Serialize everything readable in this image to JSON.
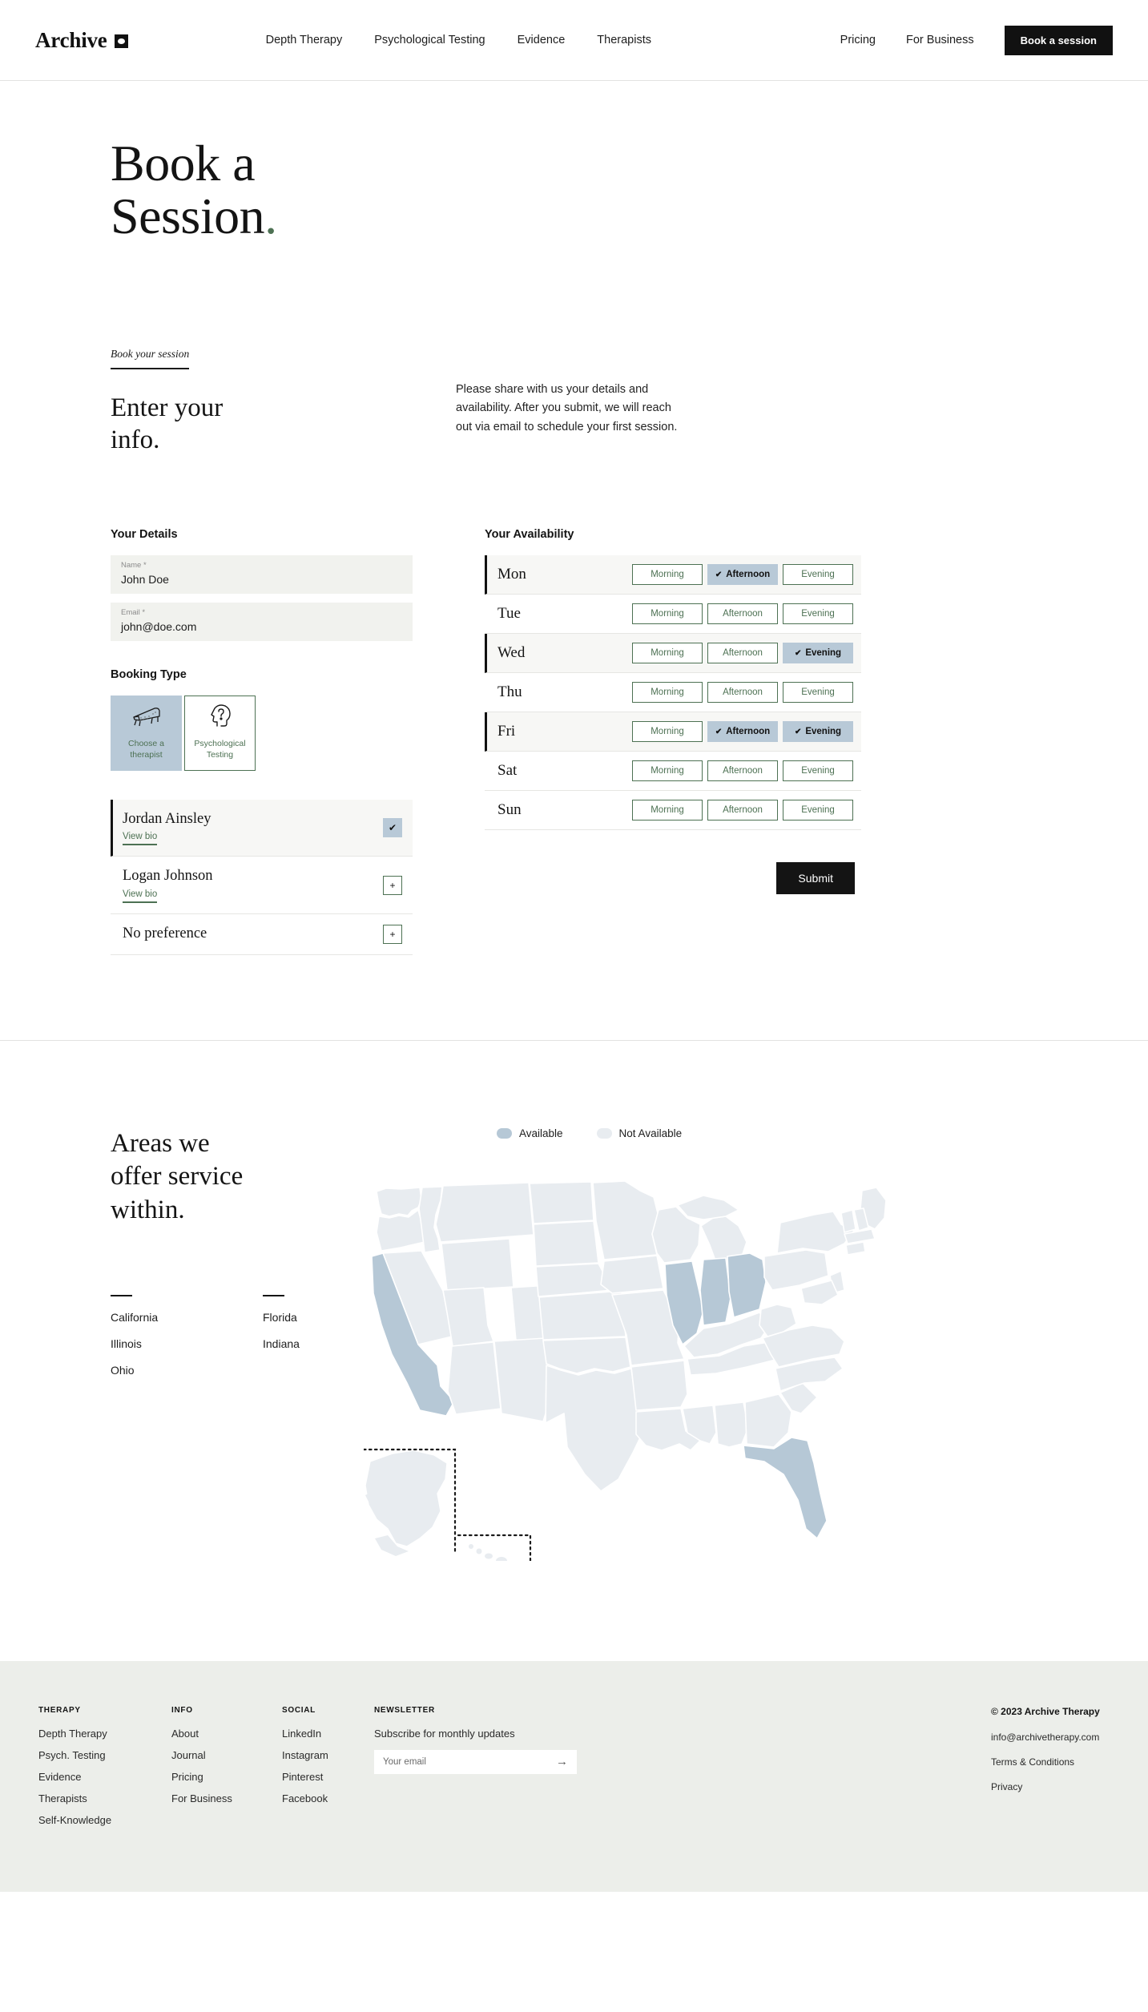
{
  "header": {
    "logo_text": "Archive",
    "nav_main": [
      {
        "label": "Depth Therapy"
      },
      {
        "label": "Psychological Testing"
      },
      {
        "label": "Evidence"
      },
      {
        "label": "Therapists"
      }
    ],
    "nav_right": [
      {
        "label": "Pricing"
      },
      {
        "label": "For Business"
      }
    ],
    "cta_label": "Book a session"
  },
  "hero": {
    "line1": "Book a",
    "line2": "Session",
    "dot": "."
  },
  "intro": {
    "eyebrow": "Book your session",
    "heading_line1": "Enter your",
    "heading_line2": "info.",
    "paragraph": "Please share with us your details and availability. After you submit, we will reach out via email to schedule your first session."
  },
  "form": {
    "details_label": "Your Details",
    "fields": [
      {
        "label": "Name *",
        "value": "John Doe",
        "placeholder": "Name"
      },
      {
        "label": "Email *",
        "value": "john@doe.com",
        "placeholder": "Email"
      }
    ],
    "booking_type_label": "Booking Type",
    "booking_types": [
      {
        "label_line1": "Choose a",
        "label_line2": "therapist",
        "icon": "couch-icon",
        "selected": true
      },
      {
        "label_line1": "Psychological",
        "label_line2": "Testing",
        "icon": "head-question-icon",
        "selected": false
      }
    ],
    "therapists": [
      {
        "name": "Jordan Ainsley",
        "bio_label": "View bio",
        "selected": true,
        "button_glyph": "✔"
      },
      {
        "name": "Logan Johnson",
        "bio_label": "View bio",
        "selected": false,
        "button_glyph": "+"
      },
      {
        "name": "No preference",
        "bio_label": "",
        "selected": false,
        "button_glyph": "+"
      }
    ],
    "availability_label": "Your Availability",
    "slot_names": [
      "Morning",
      "Afternoon",
      "Evening"
    ],
    "availability": [
      {
        "day": "Mon",
        "slots": [
          false,
          true,
          false
        ]
      },
      {
        "day": "Tue",
        "slots": [
          false,
          false,
          false
        ]
      },
      {
        "day": "Wed",
        "slots": [
          false,
          false,
          true
        ]
      },
      {
        "day": "Thu",
        "slots": [
          false,
          false,
          false
        ]
      },
      {
        "day": "Fri",
        "slots": [
          false,
          true,
          true
        ]
      },
      {
        "day": "Sat",
        "slots": [
          false,
          false,
          false
        ]
      },
      {
        "day": "Sun",
        "slots": [
          false,
          false,
          false
        ]
      }
    ],
    "submit_label": "Submit",
    "check_glyph": "✔"
  },
  "map": {
    "heading_line1": "Areas we",
    "heading_line2": "offer service",
    "heading_line3": "within.",
    "legend": [
      {
        "label": "Available",
        "color": "#b6c8d6"
      },
      {
        "label": "Not Available",
        "color": "#e8ecf0"
      }
    ],
    "state_columns": [
      [
        "California",
        "Illinois",
        "Ohio"
      ],
      [
        "Florida",
        "Indiana"
      ]
    ],
    "available_states": [
      "California",
      "Illinois",
      "Indiana",
      "Ohio",
      "Florida"
    ]
  },
  "footer": {
    "columns": [
      {
        "heading": "THERAPY",
        "links": [
          "Depth Therapy",
          "Psych. Testing",
          "Evidence",
          "Therapists",
          "Self-Knowledge"
        ]
      },
      {
        "heading": "INFO",
        "links": [
          "About",
          "Journal",
          "Pricing",
          "For Business"
        ]
      },
      {
        "heading": "SOCIAL",
        "links": [
          "LinkedIn",
          "Instagram",
          "Pinterest",
          "Facebook"
        ]
      }
    ],
    "newsletter": {
      "heading": "NEWSLETTER",
      "subtitle": "Subscribe for monthly updates",
      "placeholder": "Your email",
      "value": "",
      "arrow": "→"
    },
    "right": {
      "copyright": "© 2023 Archive Therapy",
      "links": [
        "info@archivetherapy.com",
        "Terms & Conditions",
        "Privacy"
      ]
    }
  }
}
